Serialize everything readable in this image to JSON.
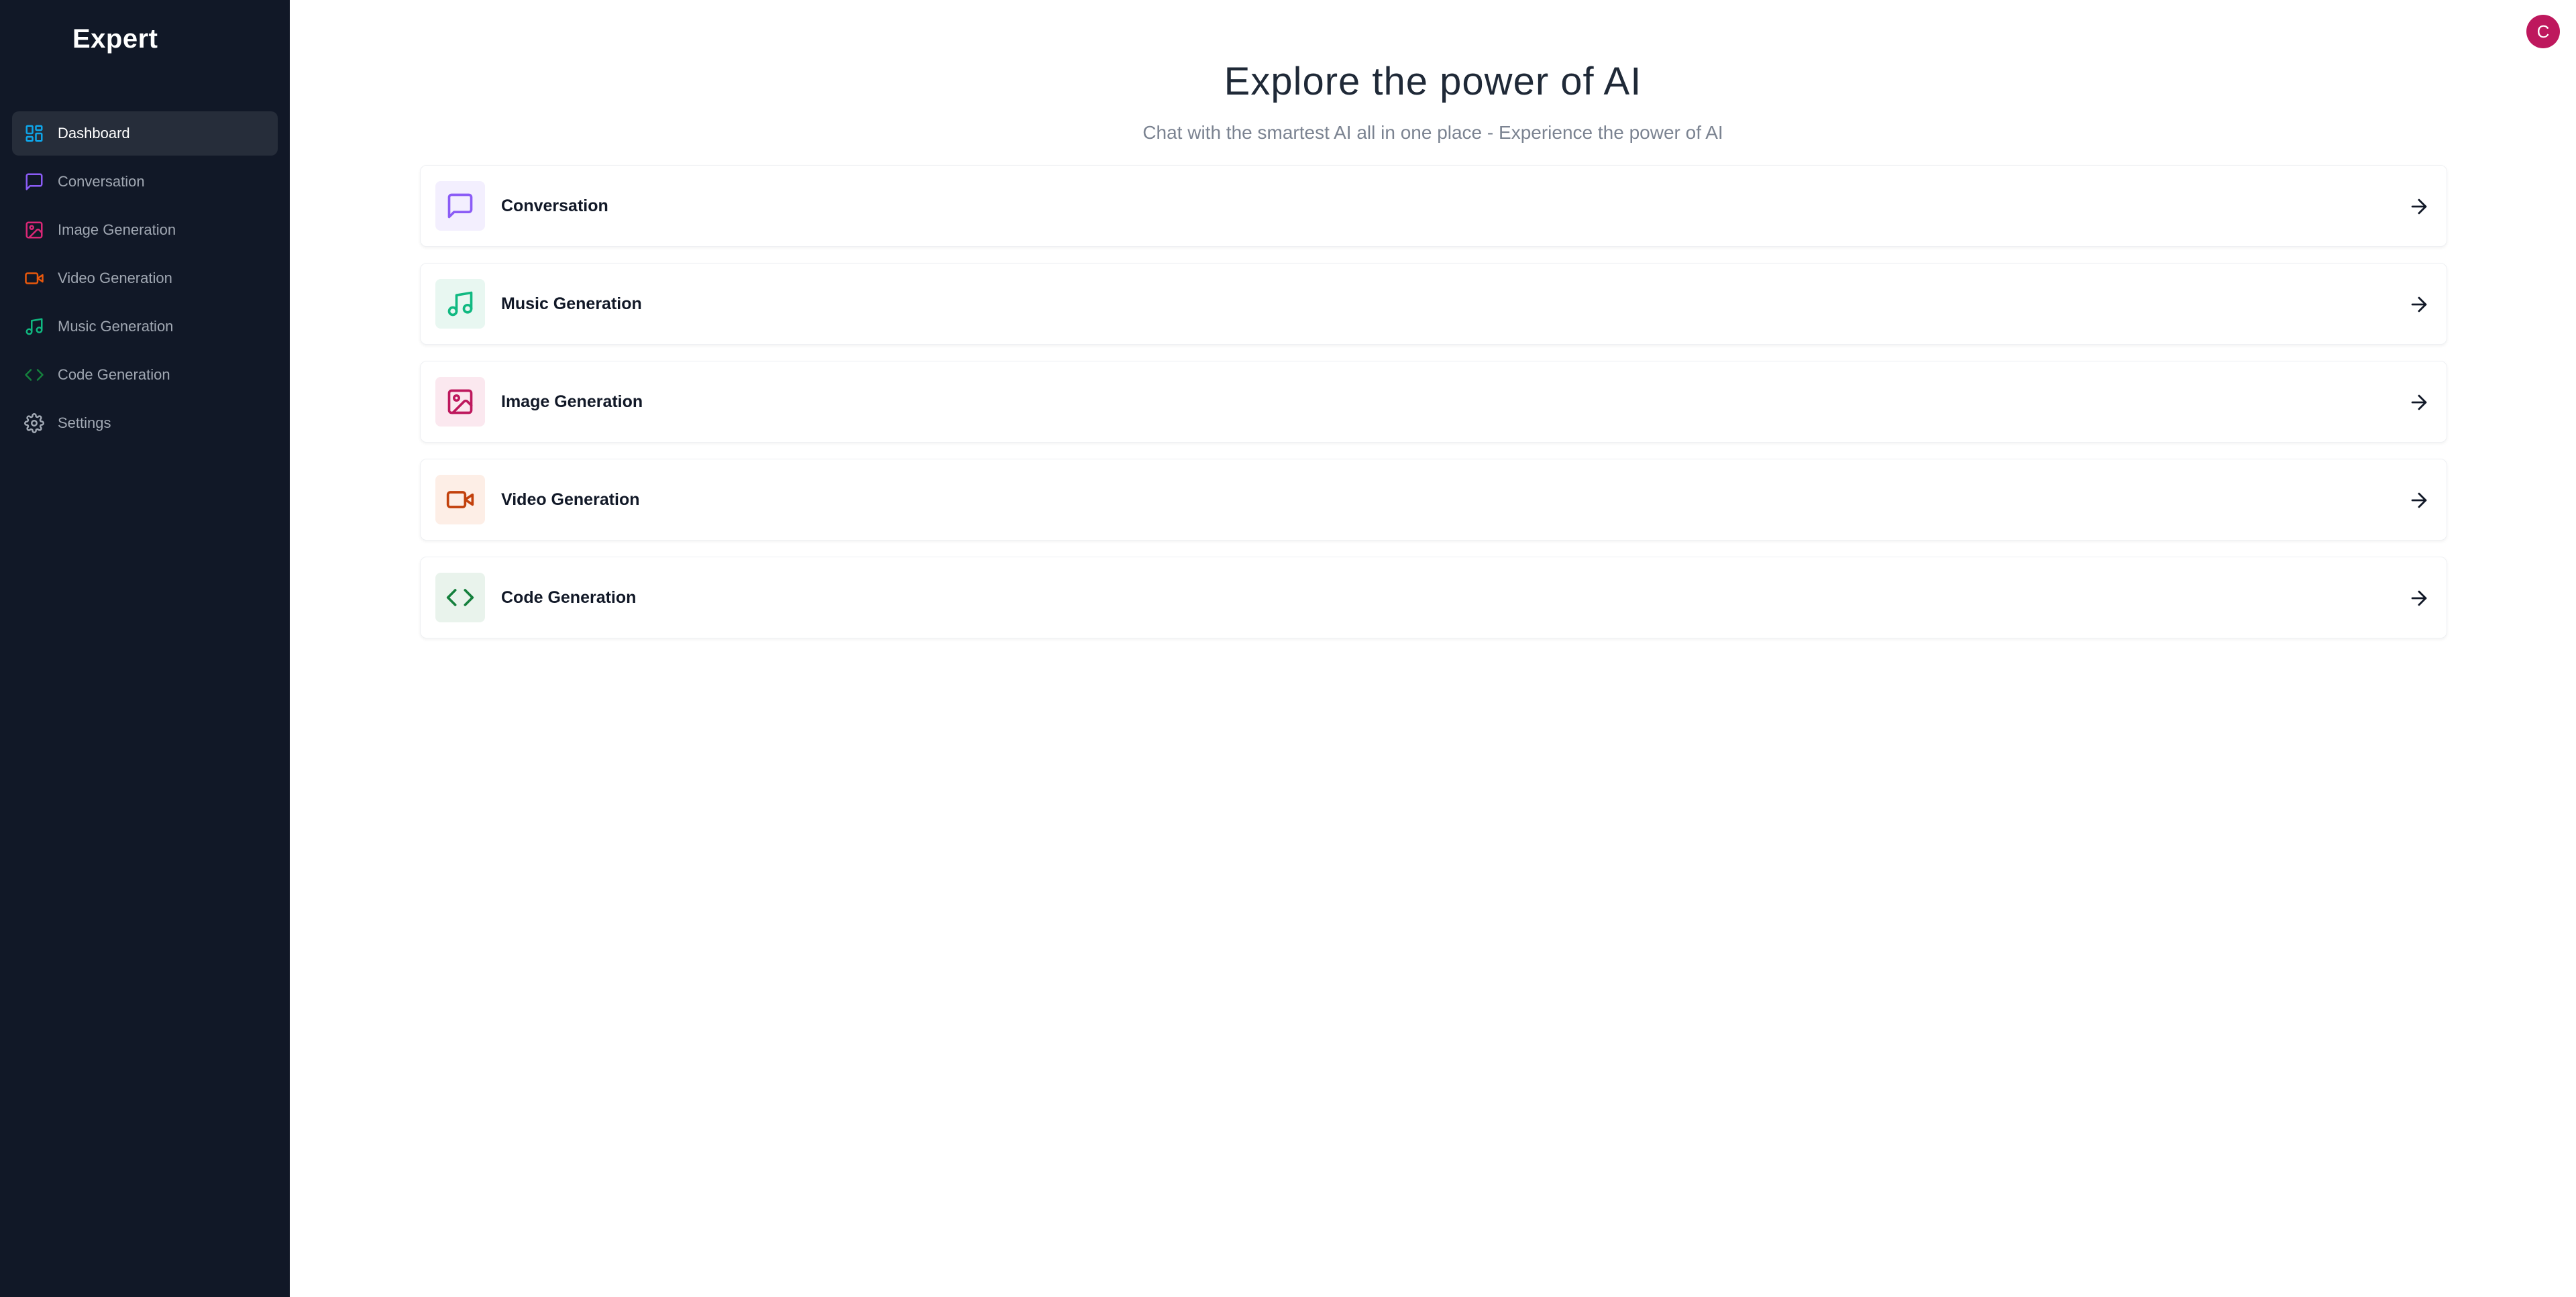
{
  "app": {
    "name": "Expert"
  },
  "user": {
    "avatar_initial": "C",
    "avatar_color": "#be185d"
  },
  "sidebar": {
    "items": [
      {
        "label": "Dashboard",
        "icon": "layout-dashboard-icon",
        "color": "#0ea5e9",
        "active": true
      },
      {
        "label": "Conversation",
        "icon": "message-square-icon",
        "color": "#8b5cf6"
      },
      {
        "label": "Image Generation",
        "icon": "image-icon",
        "color": "#db2777"
      },
      {
        "label": "Video Generation",
        "icon": "video-icon",
        "color": "#ea580c"
      },
      {
        "label": "Music Generation",
        "icon": "music-icon",
        "color": "#10b981"
      },
      {
        "label": "Code Generation",
        "icon": "code-icon",
        "color": "#15803d"
      },
      {
        "label": "Settings",
        "icon": "settings-icon",
        "color": "#a1a8b3"
      }
    ]
  },
  "hero": {
    "title": "Explore the power of AI",
    "subtitle": "Chat with the smartest AI all in one place - Experience the power of AI"
  },
  "tools": [
    {
      "label": "Conversation",
      "icon": "message-square-icon",
      "color": "#8b5cf6",
      "bg": "#f3effe"
    },
    {
      "label": "Music Generation",
      "icon": "music-icon",
      "color": "#10b981",
      "bg": "#e8f7f1"
    },
    {
      "label": "Image Generation",
      "icon": "image-icon",
      "color": "#be185d",
      "bg": "#fbe8ef"
    },
    {
      "label": "Video Generation",
      "icon": "video-icon",
      "color": "#c2410c",
      "bg": "#fdeee6"
    },
    {
      "label": "Code Generation",
      "icon": "code-icon",
      "color": "#15803d",
      "bg": "#e9f3ec"
    }
  ]
}
